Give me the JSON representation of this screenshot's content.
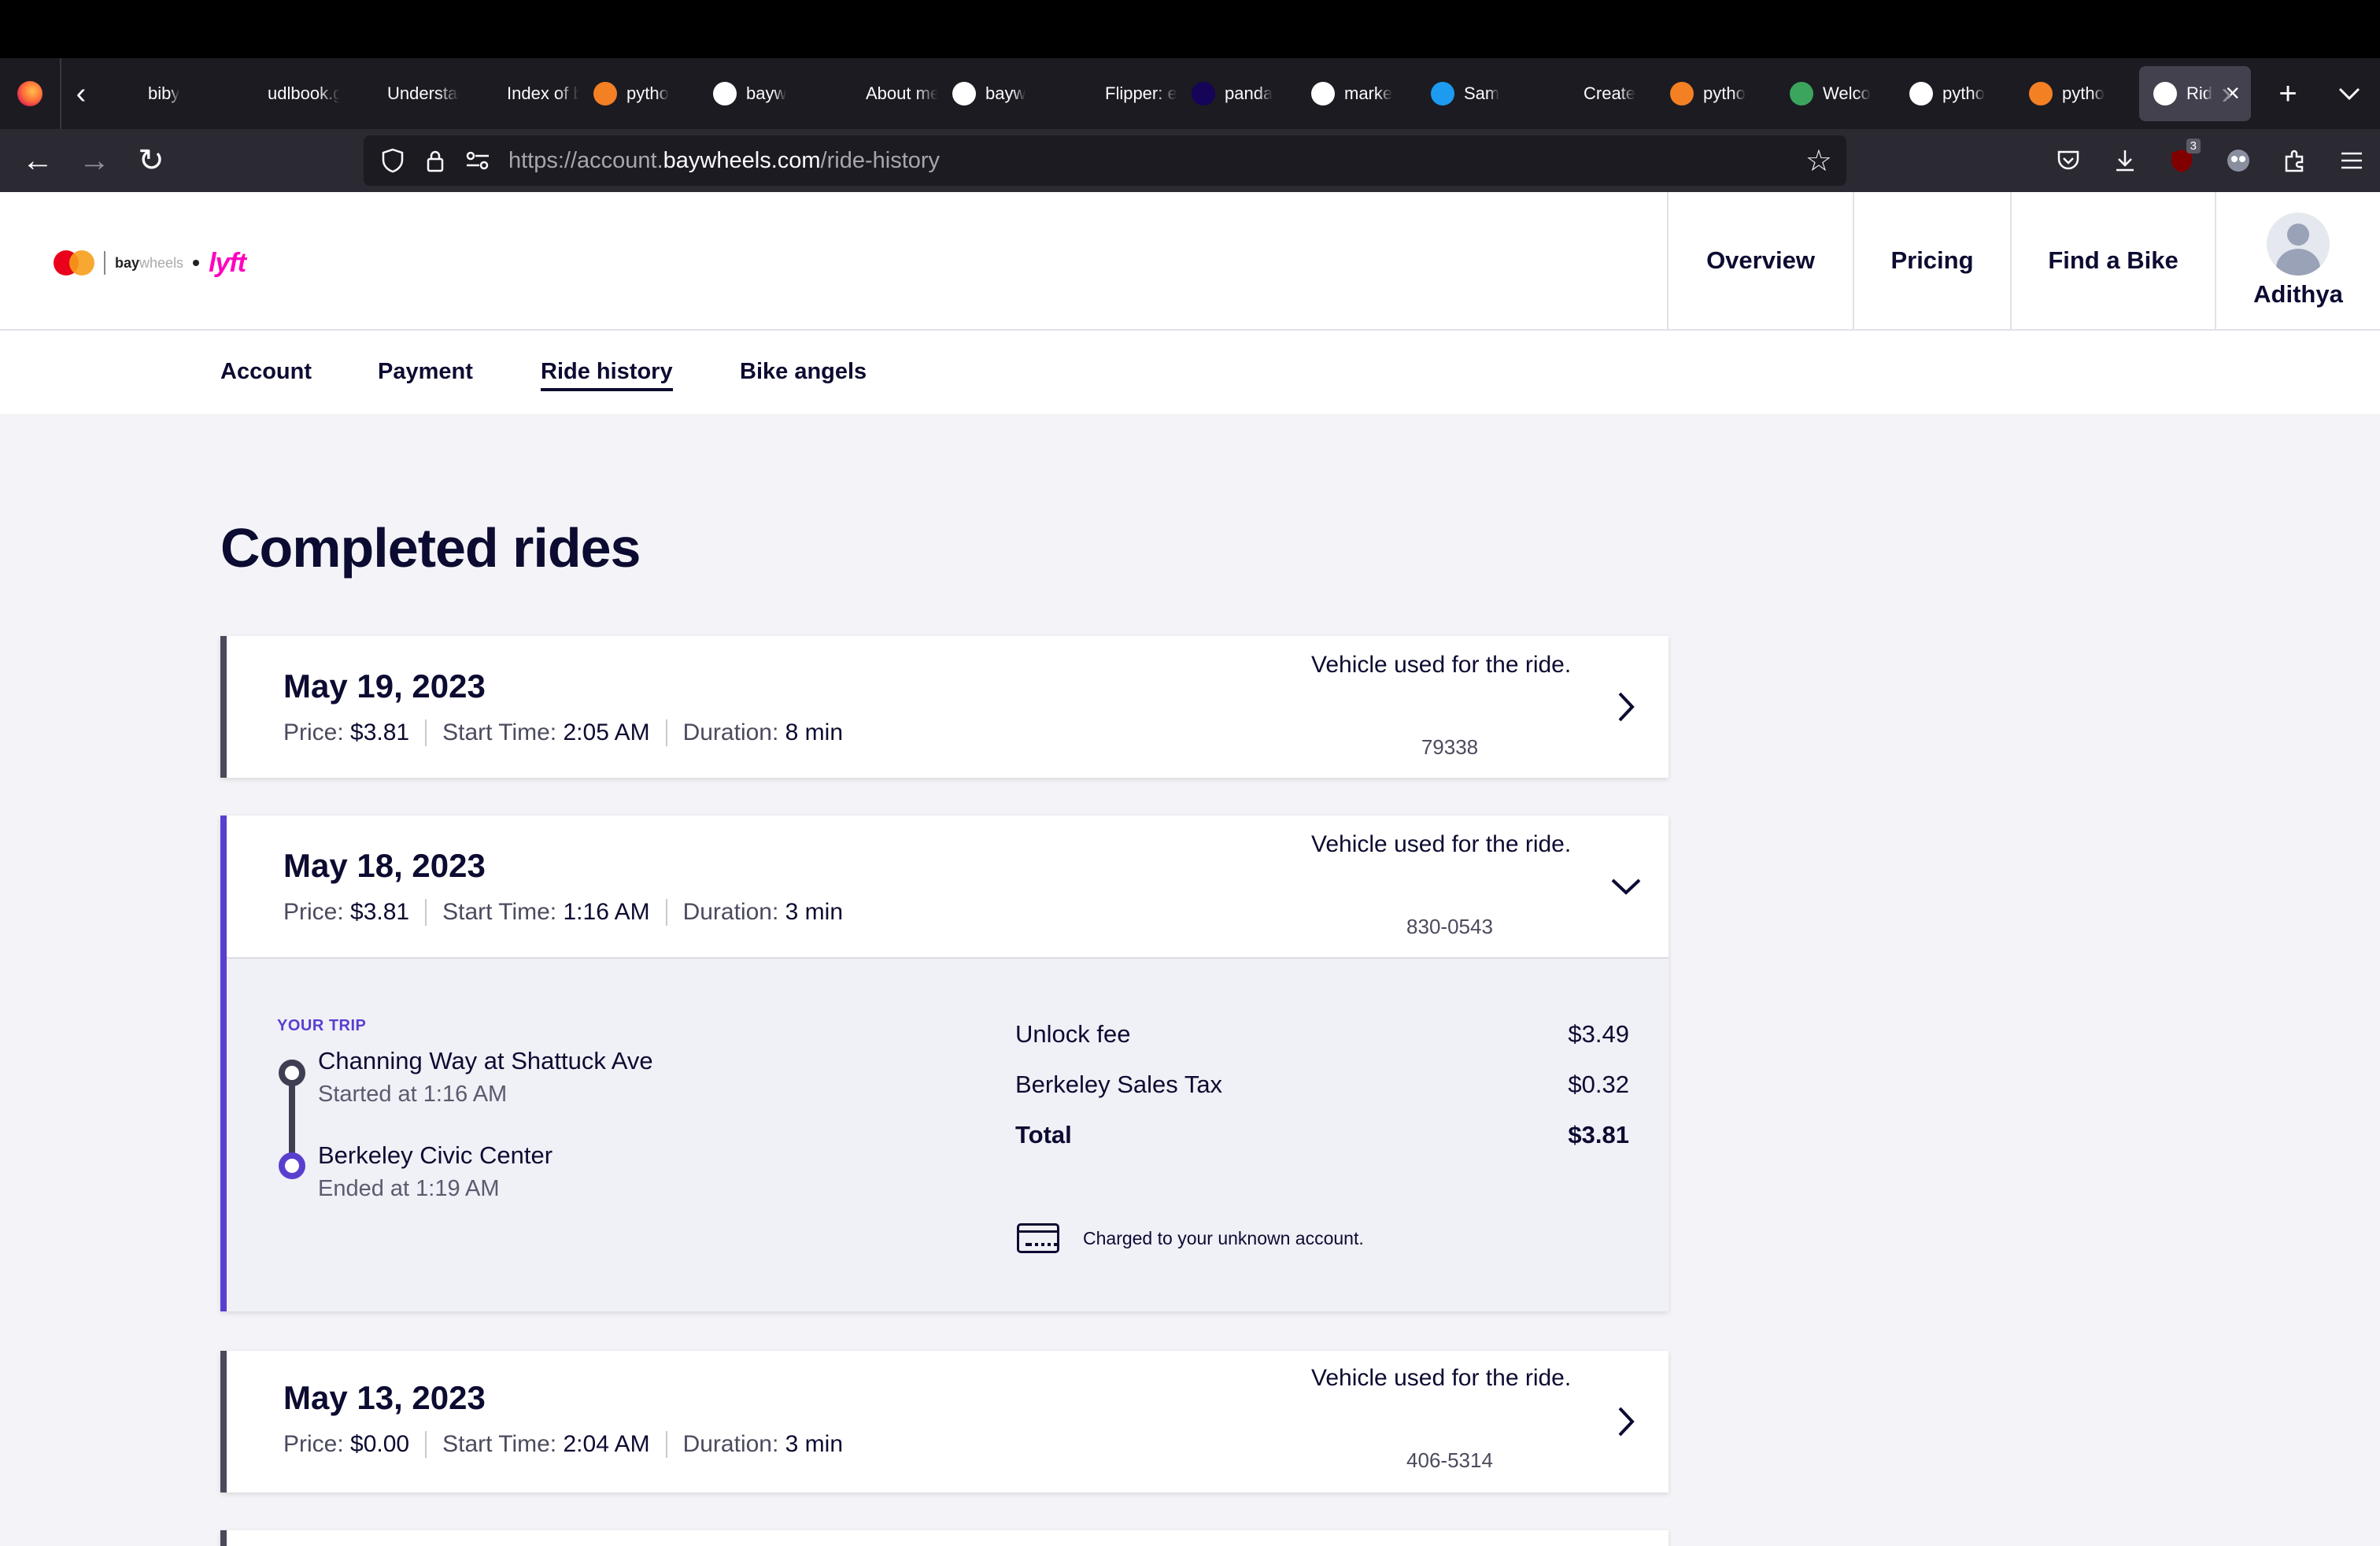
{
  "browser": {
    "tabs": [
      {
        "label": "biby",
        "icon_color": "#1c1b22"
      },
      {
        "label": "udlbook.g",
        "icon_color": "#1c1b22"
      },
      {
        "label": "Understan",
        "icon_color": "#1c1b22"
      },
      {
        "label": "Index of b",
        "icon_color": "#1c1b22"
      },
      {
        "label": "pytho",
        "icon_color": "#f48024"
      },
      {
        "label": "bayw",
        "icon_color": "#ffffff"
      },
      {
        "label": "About me",
        "icon_color": "#1c1b22"
      },
      {
        "label": "bayw",
        "icon_color": "#ffffff"
      },
      {
        "label": "Flipper: ex",
        "icon_color": "#1c1b22"
      },
      {
        "label": "panda",
        "icon_color": "#150458"
      },
      {
        "label": "marke",
        "icon_color": "#ffffff"
      },
      {
        "label": "Sam",
        "icon_color": "#1d9bf0"
      },
      {
        "label": "Create",
        "icon_color": "#1c1b22"
      },
      {
        "label": "pytho",
        "icon_color": "#f48024"
      },
      {
        "label": "Welco",
        "icon_color": "#3ba55d"
      },
      {
        "label": "pytho",
        "icon_color": "#ffffff"
      },
      {
        "label": "pytho",
        "icon_color": "#f48024"
      }
    ],
    "active_tab": {
      "label": "Rid",
      "icon_color": "#ffffff"
    },
    "url_prefix": "https://account.",
    "url_host": "baywheels.com",
    "url_path": "/ride-history",
    "extension_badge": "3"
  },
  "site": {
    "logo_text_bay": "bay",
    "logo_text_wheels": "wheels",
    "logo_lyft": "lyft",
    "nav": {
      "overview": "Overview",
      "pricing": "Pricing",
      "find_bike": "Find a Bike",
      "user_name": "Adithya"
    },
    "subnav": {
      "account": "Account",
      "payment": "Payment",
      "ride_history": "Ride history",
      "bike_angels": "Bike angels"
    }
  },
  "page": {
    "title": "Completed rides",
    "labels": {
      "price": "Price:",
      "start_time": "Start Time:",
      "duration": "Duration:",
      "vehicle": "Vehicle used for the ride."
    },
    "rides": [
      {
        "date": "May 19, 2023",
        "price": "$3.81",
        "start_time": "2:05 AM",
        "duration": "8 min",
        "vehicle_id": "79338",
        "expanded": false
      },
      {
        "date": "May 18, 2023",
        "price": "$3.81",
        "start_time": "1:16 AM",
        "duration": "3 min",
        "vehicle_id": "830-0543",
        "expanded": true
      },
      {
        "date": "May 13, 2023",
        "price": "$0.00",
        "start_time": "2:04 AM",
        "duration": "3 min",
        "vehicle_id": "406-5314",
        "expanded": false
      }
    ],
    "trip_detail": {
      "heading": "YOUR TRIP",
      "start_station": "Channing Way at Shattuck Ave",
      "start_time": "Started at 1:16 AM",
      "end_station": "Berkeley Civic Center",
      "end_time": "Ended at 1:19 AM",
      "fees": [
        {
          "label": "Unlock fee",
          "amount": "$3.49"
        },
        {
          "label": "Berkeley Sales Tax",
          "amount": "$0.32"
        }
      ],
      "total_label": "Total",
      "total_amount": "$3.81",
      "charged_text": "Charged to your unknown account."
    }
  },
  "colors": {
    "accent": "#5a3fcf",
    "text": "#0c0b31",
    "lyft": "#ff00bf"
  }
}
